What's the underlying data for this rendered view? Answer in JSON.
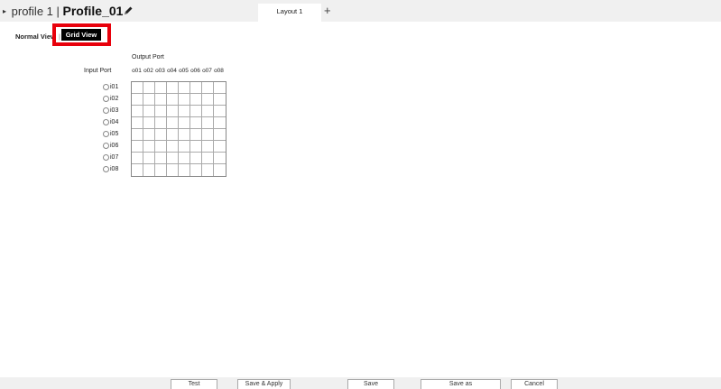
{
  "header": {
    "profile_prefix": "profile 1 |",
    "profile_name": "Profile_01",
    "edit_icon": "pencil-icon",
    "tab_label": "Layout 1",
    "add_tab_label": "+"
  },
  "view_toggle": {
    "normal_label": "Normal View",
    "separator": "|",
    "grid_label": "Grid View",
    "highlight_color": "#e8000b"
  },
  "matrix": {
    "output_port_label": "Output Port",
    "input_port_label": "Input Port",
    "outputs": [
      "o01",
      "o02",
      "o03",
      "o04",
      "o05",
      "o06",
      "o07",
      "o08"
    ],
    "inputs": [
      "i01",
      "i02",
      "i03",
      "i04",
      "i05",
      "i06",
      "i07",
      "i08"
    ]
  },
  "footer": {
    "test_label": "Test",
    "save_apply_label": "Save & Apply",
    "save_label": "Save",
    "save_as_label": "Save as",
    "cancel_label": "Cancel"
  }
}
